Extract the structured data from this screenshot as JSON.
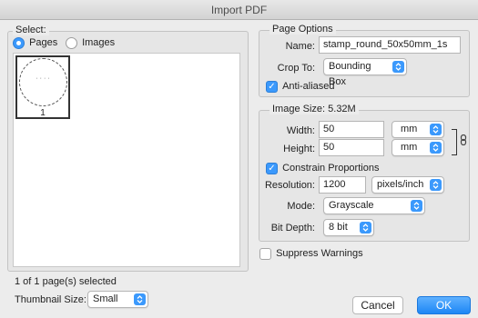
{
  "window": {
    "title": "Import PDF"
  },
  "select_panel": {
    "legend": "Select:",
    "radio_pages": "Pages",
    "radio_images": "Images",
    "thumbnail": {
      "placeholder_text": "· · · ·",
      "page_number": "1"
    },
    "status": "1 of 1 page(s) selected",
    "thumbnail_size_label": "Thumbnail Size:",
    "thumbnail_size_value": "Small"
  },
  "page_options": {
    "legend": "Page Options",
    "name_label": "Name:",
    "name_value": "stamp_round_50x50mm_1s",
    "crop_label": "Crop To:",
    "crop_value": "Bounding Box",
    "anti_aliased_label": "Anti-aliased",
    "anti_aliased_checked": true
  },
  "image_size": {
    "legend": "Image Size: 5.32M",
    "width_label": "Width:",
    "width_value": "50",
    "width_unit": "mm",
    "height_label": "Height:",
    "height_value": "50",
    "height_unit": "mm",
    "constrain_label": "Constrain Proportions",
    "constrain_checked": true,
    "resolution_label": "Resolution:",
    "resolution_value": "1200",
    "resolution_unit": "pixels/inch",
    "mode_label": "Mode:",
    "mode_value": "Grayscale",
    "bit_depth_label": "Bit Depth:",
    "bit_depth_value": "8 bit"
  },
  "suppress_warnings_label": "Suppress Warnings",
  "buttons": {
    "cancel": "Cancel",
    "ok": "OK"
  },
  "colors": {
    "accent": "#3b99fc",
    "ok_button": "#1d86f5"
  }
}
